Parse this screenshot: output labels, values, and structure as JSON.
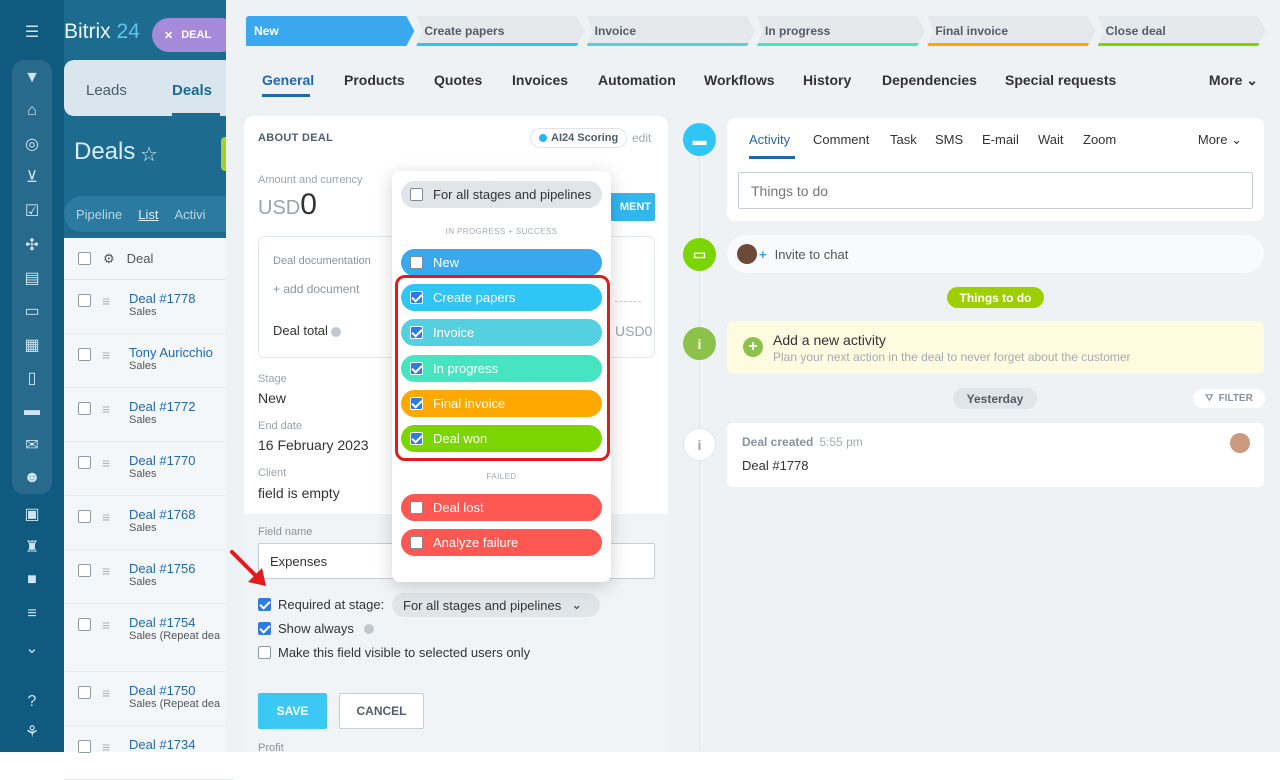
{
  "app": {
    "logo_text": "Bitrix",
    "logo_num": "24",
    "deal_chip": "DEAL"
  },
  "background": {
    "tabs": [
      "Leads",
      "Deals"
    ],
    "title": "Deals",
    "filters": [
      "Pipeline",
      "List",
      "Activi"
    ],
    "list_header": "Deal",
    "rows": [
      {
        "name": "Deal #1778",
        "sub": "Sales"
      },
      {
        "name": "Tony Auricchio",
        "sub": "Sales"
      },
      {
        "name": "Deal #1772",
        "sub": "Sales"
      },
      {
        "name": "Deal #1770",
        "sub": "Sales"
      },
      {
        "name": "Deal #1768",
        "sub": "Sales"
      },
      {
        "name": "Deal #1756",
        "sub": "Sales"
      },
      {
        "name": "Deal #1754",
        "sub": "Sales (Repeat dea"
      },
      {
        "name": "Deal #1750",
        "sub": "Sales (Repeat dea"
      },
      {
        "name": "Deal #1734",
        "sub": ""
      }
    ]
  },
  "stages": [
    {
      "label": "New",
      "color": "#39a8ef"
    },
    {
      "label": "Create papers",
      "color": "#2fc6f6"
    },
    {
      "label": "Invoice",
      "color": "#55d0e0"
    },
    {
      "label": "In progress",
      "color": "#47e4c2"
    },
    {
      "label": "Final invoice",
      "color": "#ffa900"
    },
    {
      "label": "Close deal",
      "color": "#7bd500"
    }
  ],
  "main_tabs": [
    "General",
    "Products",
    "Quotes",
    "Invoices",
    "Automation",
    "Workflows",
    "History",
    "Dependencies",
    "Special requests"
  ],
  "main_tabs_more": "More",
  "about": {
    "title": "ABOUT DEAL",
    "ai_badge": "AI24 Scoring",
    "edit": "edit",
    "amount_label": "Amount and currency",
    "currency": "USD",
    "amount": "0",
    "payment_btn": "MENT",
    "docs_title": "Deal documentation",
    "add_doc": "+ add document",
    "deal_total": "Deal total",
    "total_value": "USD0",
    "stage_label": "Stage",
    "stage_value": "New",
    "end_date_label": "End date",
    "end_date_value": "16 February 2023",
    "client_label": "Client",
    "client_value": "field is empty"
  },
  "editor": {
    "field_name_label": "Field name",
    "field_name_value": "Expenses",
    "required_label": "Required at stage:",
    "stage_select": "For all stages and pipelines",
    "show_always": "Show always",
    "visible_selected": "Make this field visible to selected users only",
    "save": "SAVE",
    "cancel": "CANCEL",
    "profit": "Profit"
  },
  "dropdown": {
    "all": "For all stages and pipelines",
    "sep_success": "IN PROGRESS + SUCCESS",
    "sep_failed": "FAILED",
    "items": [
      {
        "label": "New",
        "checked": false,
        "color": "#39a8ef"
      },
      {
        "label": "Create papers",
        "checked": true,
        "color": "#2fc6f6"
      },
      {
        "label": "Invoice",
        "checked": true,
        "color": "#55d0e0"
      },
      {
        "label": "In progress",
        "checked": true,
        "color": "#47e4c2"
      },
      {
        "label": "Final invoice",
        "checked": true,
        "color": "#ffa900"
      },
      {
        "label": "Deal won",
        "checked": true,
        "color": "#7bd500"
      },
      {
        "label": "Deal lost",
        "checked": false,
        "color": "#ff5752"
      },
      {
        "label": "Analyze failure",
        "checked": false,
        "color": "#ff5752"
      }
    ]
  },
  "activity": {
    "tabs": [
      "Activity",
      "Comment",
      "Task",
      "SMS",
      "E-mail",
      "Wait",
      "Zoom"
    ],
    "more": "More",
    "placeholder": "Things to do",
    "invite": "Invite to chat",
    "todo_pill": "Things to do",
    "new_title": "Add a new activity",
    "new_sub": "Plan your next action in the deal to never forget about the customer",
    "yesterday": "Yesterday",
    "filter": "FILTER",
    "created_title": "Deal created",
    "created_time": "5:55 pm",
    "created_deal": "Deal #1778"
  }
}
